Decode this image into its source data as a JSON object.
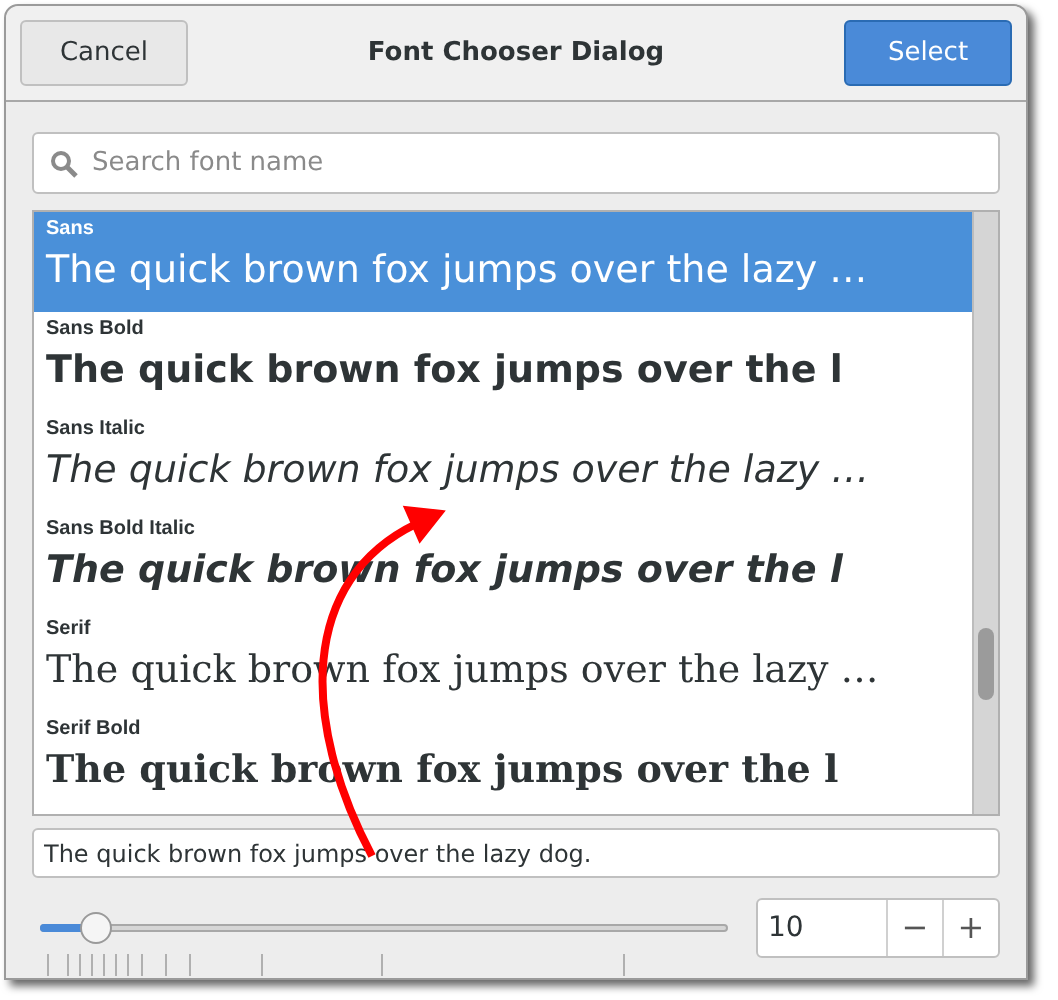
{
  "header": {
    "cancel": "Cancel",
    "title": "Font Chooser Dialog",
    "select": "Select"
  },
  "search": {
    "placeholder": "Search font name"
  },
  "fonts": [
    {
      "name": "Sans",
      "preview": "The quick brown fox jumps over the lazy …",
      "kind": "sans",
      "bold": false,
      "italic": false,
      "selected": true
    },
    {
      "name": "Sans Bold",
      "preview": "The quick brown fox jumps over the l",
      "kind": "sans",
      "bold": true,
      "italic": false,
      "selected": false
    },
    {
      "name": "Sans Italic",
      "preview": "The quick brown fox jumps over the lazy …",
      "kind": "sans",
      "bold": false,
      "italic": true,
      "selected": false
    },
    {
      "name": "Sans Bold Italic",
      "preview": "The quick brown fox jumps over the l",
      "kind": "sans",
      "bold": true,
      "italic": true,
      "selected": false
    },
    {
      "name": "Serif",
      "preview": "The quick brown fox jumps over the lazy …",
      "kind": "serif",
      "bold": false,
      "italic": false,
      "selected": false
    },
    {
      "name": "Serif Bold",
      "preview": "The quick brown fox jumps over the l",
      "kind": "serif",
      "bold": true,
      "italic": false,
      "selected": false
    }
  ],
  "preview_field": {
    "value": "The quick brown fox jumps over the lazy dog."
  },
  "size": {
    "level": 0.08,
    "value": "10",
    "decrement": "−",
    "increment": "+"
  }
}
